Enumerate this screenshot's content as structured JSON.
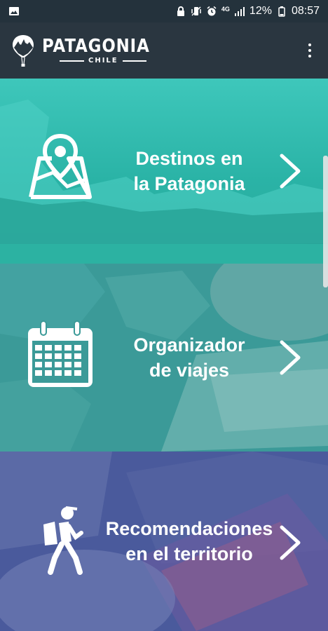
{
  "status_bar": {
    "battery_percent": "12%",
    "time": "08:57",
    "network": "4G",
    "icons": [
      "image-notification-icon",
      "lock-icon",
      "vibrate-icon",
      "alarm-icon",
      "network-4g-icon",
      "signal-icon",
      "battery-icon"
    ]
  },
  "app_bar": {
    "logo_title": "PATAGONIA",
    "logo_subtitle": "CHILE",
    "menu_icon": "overflow-menu-icon"
  },
  "cards": [
    {
      "line1": "Destinos en",
      "line2": "la Patagonia",
      "icon": "map-pin-icon",
      "color": "#2bb7a8"
    },
    {
      "line1": "Organizador",
      "line2": "de viajes",
      "icon": "calendar-icon",
      "color": "#3d9c9a"
    },
    {
      "line1": "Recomendaciones",
      "line2": "en el territorio",
      "icon": "hiker-icon",
      "color": "#4a5a9c"
    }
  ]
}
